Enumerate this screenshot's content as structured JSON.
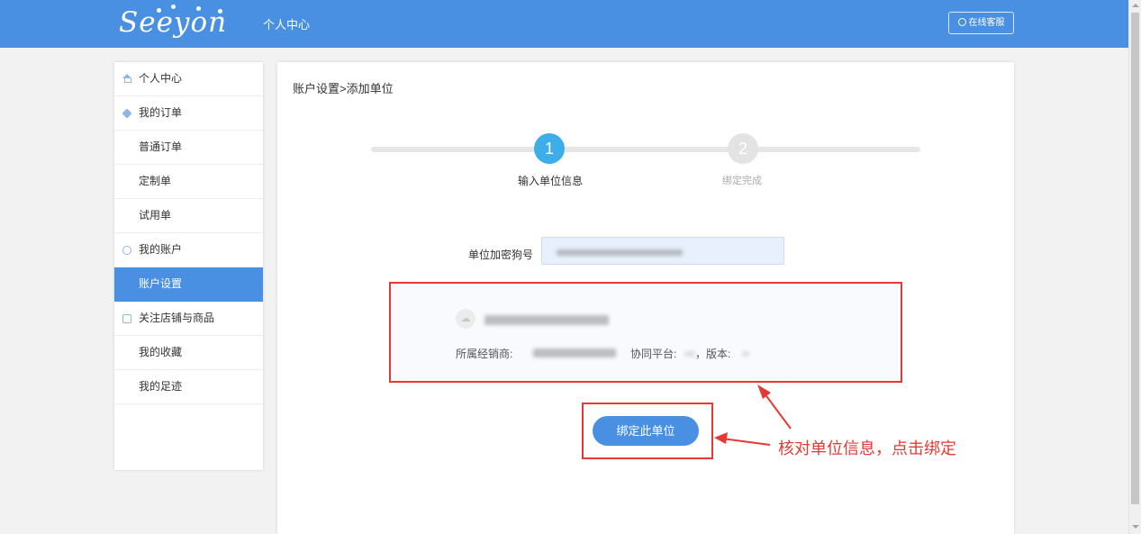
{
  "header": {
    "logo_text": "Seeyon",
    "title": "个人中心",
    "support_label": "在线客服",
    "brand_color": "#4a90e2"
  },
  "sidebar": {
    "items": [
      {
        "label": "个人中心",
        "icon": "home-icon"
      },
      {
        "label": "我的订单",
        "icon": "cube-icon"
      },
      {
        "label": "普通订单"
      },
      {
        "label": "定制单"
      },
      {
        "label": "试用单"
      },
      {
        "label": "我的账户",
        "icon": "account-icon"
      },
      {
        "label": "账户设置",
        "active": true
      },
      {
        "label": "关注店铺与商品",
        "icon": "store-icon"
      },
      {
        "label": "我的收藏"
      },
      {
        "label": "我的足迹"
      }
    ]
  },
  "main": {
    "breadcrumb": "账户设置>添加单位",
    "steps": [
      {
        "number": "1",
        "label": "输入单位信息",
        "status": "active"
      },
      {
        "number": "2",
        "label": "绑定完成",
        "status": "pending"
      }
    ],
    "dongle_label": "单位加密狗号",
    "info": {
      "dealer_label": "所属经销商:",
      "platform_label": "协同平台:",
      "version_label": "，版本:"
    },
    "bind_button": "绑定此单位"
  },
  "annotation": {
    "text": "核对单位信息，点击绑定",
    "color": "#e53935"
  }
}
